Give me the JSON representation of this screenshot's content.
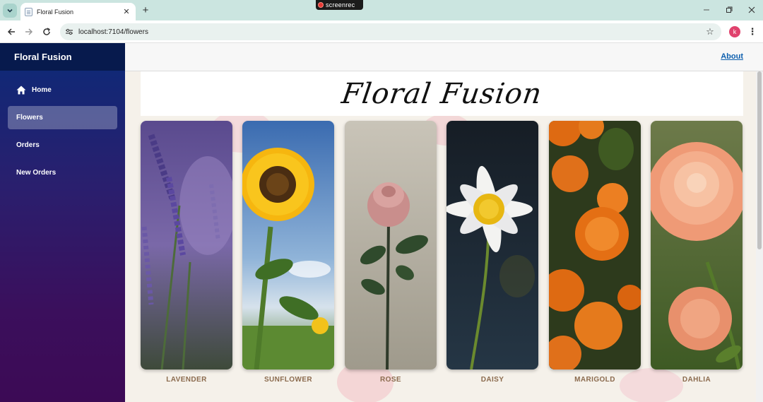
{
  "browser": {
    "tab_title": "Floral Fusion",
    "url": "localhost:7104/flowers",
    "recorder_label": "screenrec",
    "profile_initial": "k"
  },
  "sidebar": {
    "brand": "Floral Fusion",
    "items": [
      {
        "label": "Home",
        "icon": "home-icon",
        "active": false
      },
      {
        "label": "Flowers",
        "active": true
      },
      {
        "label": "Orders",
        "active": false
      },
      {
        "label": "New Orders",
        "active": false
      }
    ]
  },
  "topbar": {
    "about_label": "About"
  },
  "main": {
    "hero_title": "Floral Fusion",
    "flowers": [
      {
        "name": "LAVENDER",
        "image": "lavender-photo"
      },
      {
        "name": "SUNFLOWER",
        "image": "sunflower-photo"
      },
      {
        "name": "ROSE",
        "image": "rose-photo"
      },
      {
        "name": "DAISY",
        "image": "daisy-photo"
      },
      {
        "name": "MARIGOLD",
        "image": "marigold-photo"
      },
      {
        "name": "DAHLIA",
        "image": "dahlia-photo"
      }
    ]
  },
  "colors": {
    "sidebar_top": "#0b2a78",
    "sidebar_bottom": "#3c0a55",
    "link": "#0d5fae",
    "label": "#8b6b4e"
  }
}
